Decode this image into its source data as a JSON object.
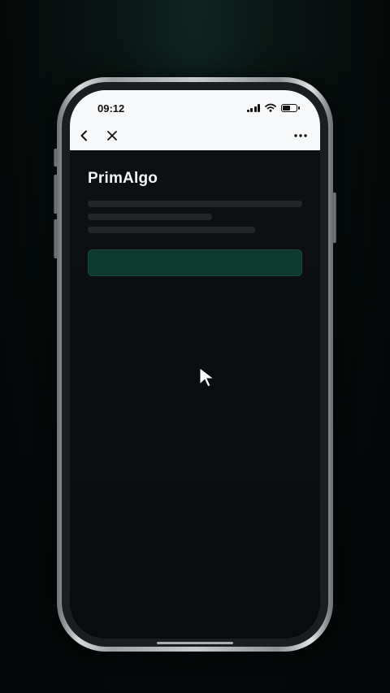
{
  "status_bar": {
    "time": "09:12",
    "signal_icon": "cellular-signal-icon",
    "wifi_icon": "wifi-icon",
    "battery_icon": "battery-icon",
    "battery_level": 0.5
  },
  "browser_nav": {
    "back_icon": "chevron-left-icon",
    "close_icon": "close-icon",
    "more_icon": "more-horizontal-icon"
  },
  "page": {
    "title": "PrimAlgo",
    "primary_button_label": ""
  },
  "colors": {
    "background": "#081311",
    "screen": "#0b0f11",
    "header": "#f7f8fa",
    "skeleton": "#22272b",
    "accent_button": "#0f3a30"
  }
}
